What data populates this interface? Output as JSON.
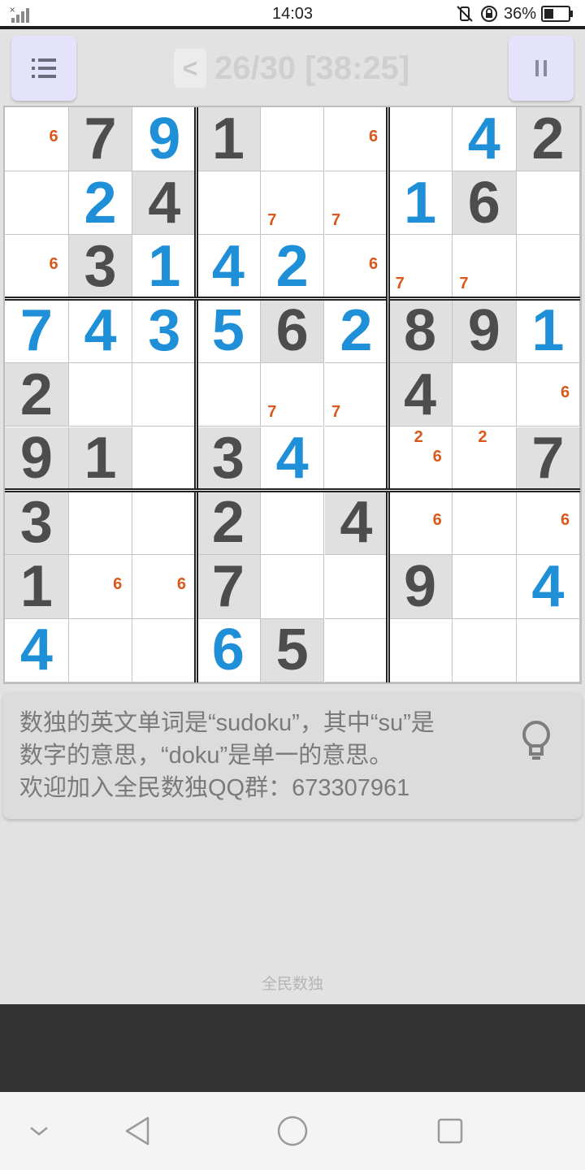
{
  "status_bar": {
    "time": "14:03",
    "battery": "36%"
  },
  "header": {
    "progress": "26/30 [38:25]",
    "prev_label": "<"
  },
  "board": {
    "cells": [
      [
        {
          "n": "6"
        },
        {
          "g": "7"
        },
        {
          "f": "9"
        },
        {
          "g": "1"
        },
        {},
        {
          "n": "6"
        },
        {},
        {
          "f": "4"
        },
        {
          "g": "2"
        }
      ],
      [
        {},
        {
          "f": "2"
        },
        {
          "g": "4"
        },
        {},
        {
          "n": "7"
        },
        {
          "n": "7"
        },
        {
          "f": "1"
        },
        {
          "g": "6"
        },
        {}
      ],
      [
        {
          "n": "6"
        },
        {
          "g": "3"
        },
        {
          "f": "1"
        },
        {
          "f": "4"
        },
        {
          "f": "2"
        },
        {
          "n": "6"
        },
        {
          "n": "7"
        },
        {
          "n": "7"
        },
        {}
      ],
      [
        {
          "f": "7"
        },
        {
          "f": "4"
        },
        {
          "f": "3"
        },
        {
          "f": "5"
        },
        {
          "g": "6"
        },
        {
          "f": "2"
        },
        {
          "g": "8"
        },
        {
          "g": "9"
        },
        {
          "f": "1"
        }
      ],
      [
        {
          "g": "2"
        },
        {},
        {},
        {},
        {
          "n": "7"
        },
        {
          "n": "7"
        },
        {
          "g": "4"
        },
        {},
        {
          "n": "6"
        }
      ],
      [
        {
          "g": "9"
        },
        {
          "g": "1"
        },
        {},
        {
          "g": "3"
        },
        {
          "f": "4"
        },
        {},
        {
          "n": "2,6"
        },
        {
          "n": "2"
        },
        {
          "g": "7"
        }
      ],
      [
        {
          "g": "3"
        },
        {},
        {},
        {
          "g": "2"
        },
        {},
        {
          "g": "4"
        },
        {
          "n": "6"
        },
        {},
        {
          "n": "6"
        }
      ],
      [
        {
          "g": "1"
        },
        {
          "n": "6"
        },
        {
          "n": "6"
        },
        {
          "g": "7"
        },
        {},
        {},
        {
          "g": "9"
        },
        {},
        {
          "f": "4"
        }
      ],
      [
        {
          "f": "4"
        },
        {},
        {},
        {
          "f": "6"
        },
        {
          "g": "5"
        },
        {},
        {},
        {},
        {}
      ]
    ]
  },
  "tip": {
    "lines": [
      "数独的英文单词是“sudoku”，其中“su”是",
      "数字的意思，“doku”是单一的意思。",
      "欢迎加入全民数独QQ群：673307961"
    ]
  },
  "footer": {
    "app_name": "全民数独"
  },
  "colors": {
    "given": "#4d4d4d",
    "filled": "#1f8fd8",
    "note": "#d9581a",
    "button_bg": "#e4e3fb"
  },
  "icons": [
    "signal-icon",
    "mute-icon",
    "rotation-lock-icon",
    "battery-icon",
    "menu-icon",
    "pause-icon",
    "lightbulb-icon",
    "nav-down-icon",
    "nav-back-icon",
    "nav-home-icon",
    "nav-recent-icon"
  ]
}
